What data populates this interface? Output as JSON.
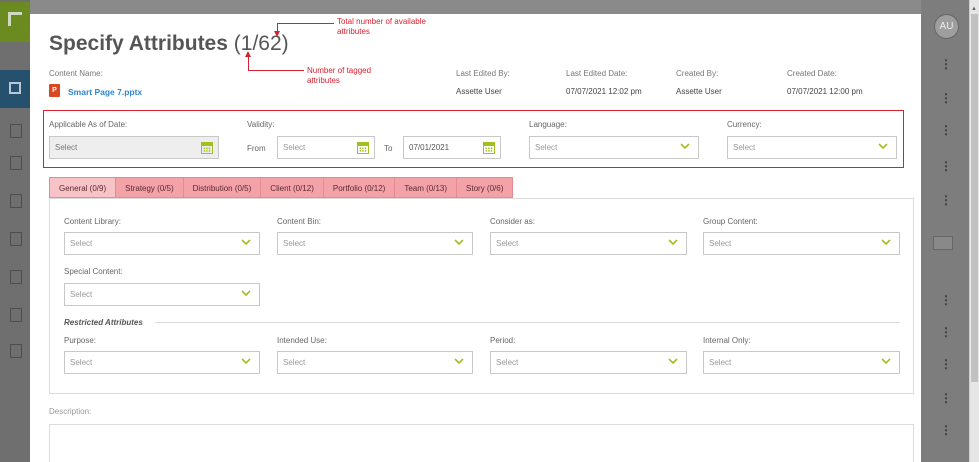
{
  "background": {
    "avatar_initials": "AU",
    "kebab_glyph": "⋮"
  },
  "modal": {
    "title": "Specify Attributes",
    "count": "(1/62)"
  },
  "meta": {
    "content_name_label": "Content Name:",
    "file_name": "Smart Page 7.pptx",
    "ppt_badge": "P",
    "last_edited_by_label": "Last Edited By:",
    "last_edited_by": "Assette User",
    "last_edited_date_label": "Last Edited Date:",
    "last_edited_date": "07/07/2021 12:02 pm",
    "created_by_label": "Created By:",
    "created_by": "Assette User",
    "created_date_label": "Created Date:",
    "created_date": "07/07/2021 12:00 pm"
  },
  "top_fields": {
    "applicable_label": "Applicable As of Date:",
    "applicable_value": "Select",
    "validity_label": "Validity:",
    "from_label": "From",
    "from_value": "Select",
    "to_label": "To",
    "to_value": "07/01/2021",
    "language_label": "Language:",
    "language_value": "Select",
    "currency_label": "Currency:",
    "currency_value": "Select"
  },
  "tabs": [
    {
      "label": "General (0/9)"
    },
    {
      "label": "Strategy (0/5)"
    },
    {
      "label": "Distribution (0/5)"
    },
    {
      "label": "Client (0/12)"
    },
    {
      "label": "Portfolio (0/12)"
    },
    {
      "label": "Team (0/13)"
    },
    {
      "label": "Story (0/6)"
    }
  ],
  "general": {
    "content_library_label": "Content Library:",
    "content_bin_label": "Content Bin:",
    "consider_as_label": "Consider as:",
    "group_content_label": "Group Content:",
    "special_content_label": "Special Content:",
    "restricted_title": "Restricted Attributes",
    "purpose_label": "Purpose:",
    "intended_use_label": "Intended Use:",
    "period_label": "Period:",
    "internal_only_label": "Internal Only:",
    "select_placeholder": "Select"
  },
  "description_label": "Description:",
  "annotations": {
    "total_line1": "Total number of available",
    "total_line2": "attributes",
    "tagged_line1": "Number of tagged",
    "tagged_line2": "attributes"
  },
  "colors": {
    "accent_green": "#a0c020",
    "tab_pink": "#f3a2a8",
    "annotation_red": "#d62230",
    "link_blue": "#2e86d0"
  }
}
